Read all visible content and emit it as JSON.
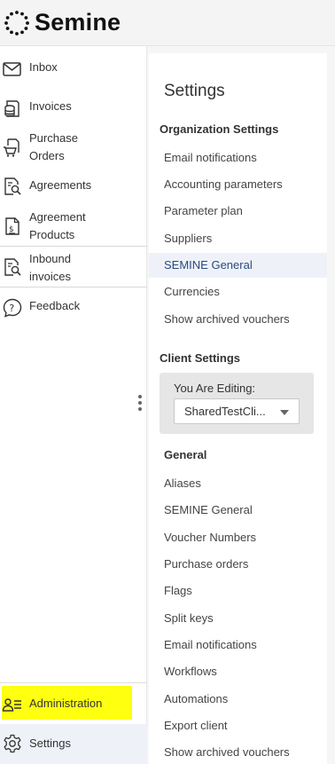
{
  "app": {
    "brand": "Semine"
  },
  "sidebar": {
    "items": [
      {
        "label": "Inbox",
        "icon": "envelope-icon"
      },
      {
        "label": "Invoices",
        "icon": "stack-icon"
      },
      {
        "label": "Purchase Orders",
        "icon": "cart-document-icon"
      },
      {
        "label": "Agreements",
        "icon": "document-search-icon"
      },
      {
        "label": "Agreement Products",
        "icon": "dollar-document-icon"
      },
      {
        "label": "Inbound invoices",
        "icon": "document-search-icon"
      },
      {
        "label": "Feedback",
        "icon": "question-bubble-icon"
      },
      {
        "label": "Administration",
        "icon": "user-list-icon"
      },
      {
        "label": "Settings",
        "icon": "gear-icon"
      }
    ],
    "purchase_orders_line1": "Purchase",
    "purchase_orders_line2": "Orders",
    "agreement_products_line1": "Agreement",
    "agreement_products_line2": "Products",
    "inbound_invoices_line1": "Inbound",
    "inbound_invoices_line2": "invoices"
  },
  "settings": {
    "title": "Settings",
    "organization_heading": "Organization Settings",
    "organization_links": [
      "Email notifications",
      "Accounting parameters",
      "Parameter plan",
      "Suppliers",
      "SEMINE General",
      "Currencies",
      "Show archived vouchers"
    ],
    "active_link": "SEMINE General",
    "client_heading": "Client Settings",
    "editing_label": "You Are Editing:",
    "editing_value": "SharedTestCli...",
    "general_heading": "General",
    "general_links": [
      "Aliases",
      "SEMINE General",
      "Voucher Numbers",
      "Purchase orders",
      "Flags",
      "Split keys",
      "Email notifications",
      "Workflows",
      "Automations",
      "Export client",
      "Show archived vouchers"
    ]
  },
  "colors": {
    "highlight": "#ffff10",
    "active_bg": "#eef2f8",
    "active_text": "#2a4a80"
  }
}
